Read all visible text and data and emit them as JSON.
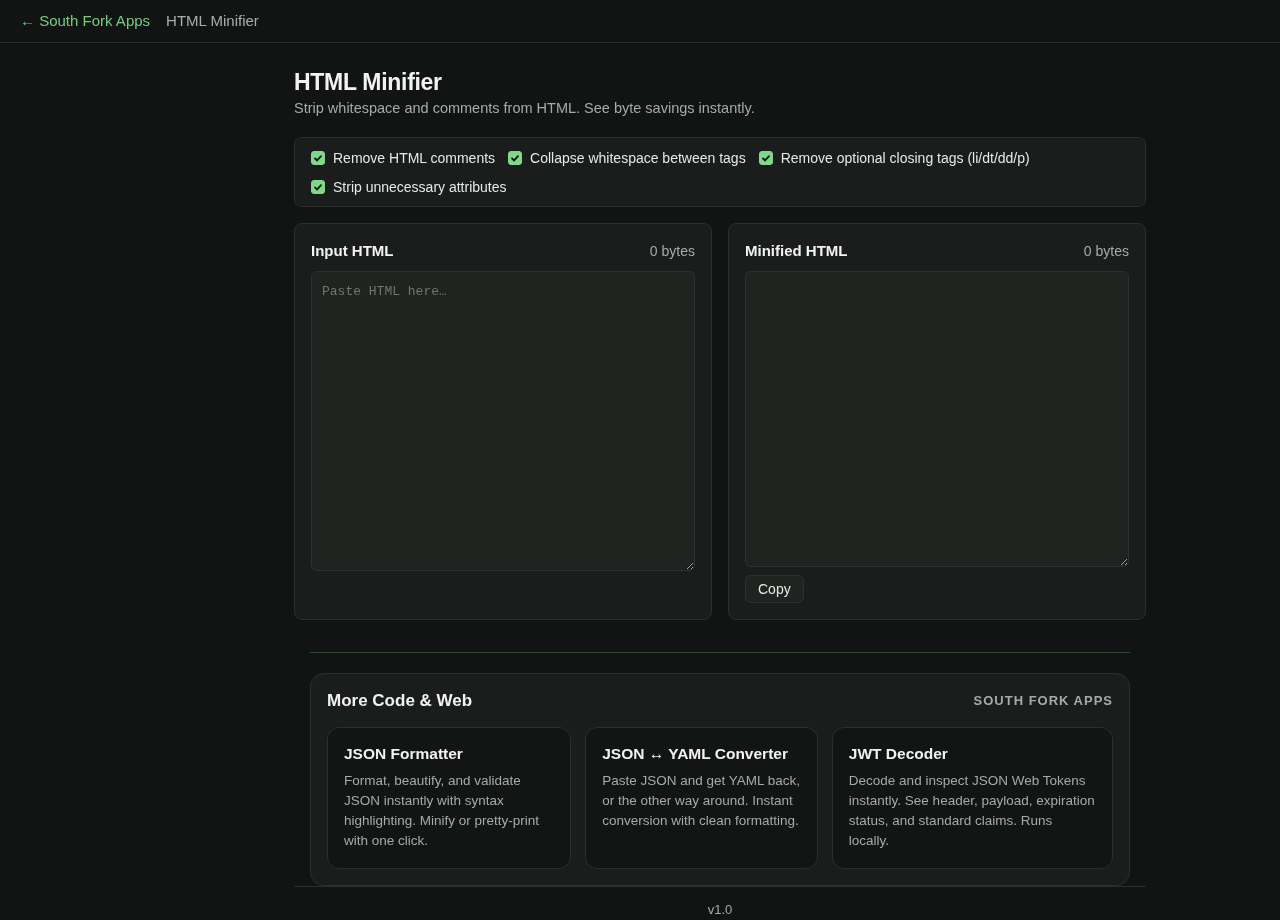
{
  "nav": {
    "back_link": "← South Fork Apps",
    "current_page": "HTML Minifier"
  },
  "header": {
    "title": "HTML Minifier",
    "subtitle": "Strip whitespace and comments from HTML. See byte savings instantly."
  },
  "options": [
    {
      "label": "Remove HTML comments",
      "checked": true
    },
    {
      "label": "Collapse whitespace between tags",
      "checked": true
    },
    {
      "label": "Remove optional closing tags (li/dt/dd/p)",
      "checked": true
    },
    {
      "label": "Strip unnecessary attributes",
      "checked": true
    }
  ],
  "panels": [
    {
      "title": "Input HTML",
      "byte_count": "0 bytes",
      "placeholder": "Paste HTML here…"
    },
    {
      "title": "Minified HTML",
      "byte_count": "0 bytes",
      "button": "Copy"
    }
  ],
  "more": {
    "title": "More Code & Web",
    "brand": "SOUTH FORK APPS",
    "cards": [
      {
        "title": "JSON Formatter",
        "description": "Format, beautify, and validate JSON instantly with syntax highlighting. Minify or pretty-print with one click."
      },
      {
        "title": "JSON ↔ YAML Converter",
        "description": "Paste JSON and get YAML back, or the other way around. Instant conversion with clean formatting."
      },
      {
        "title": "JWT Decoder",
        "description": "Decode and inspect JSON Web Tokens instantly. See header, payload, expiration status, and standard claims. Runs locally."
      }
    ]
  },
  "footer": {
    "version": "v1.0"
  }
}
